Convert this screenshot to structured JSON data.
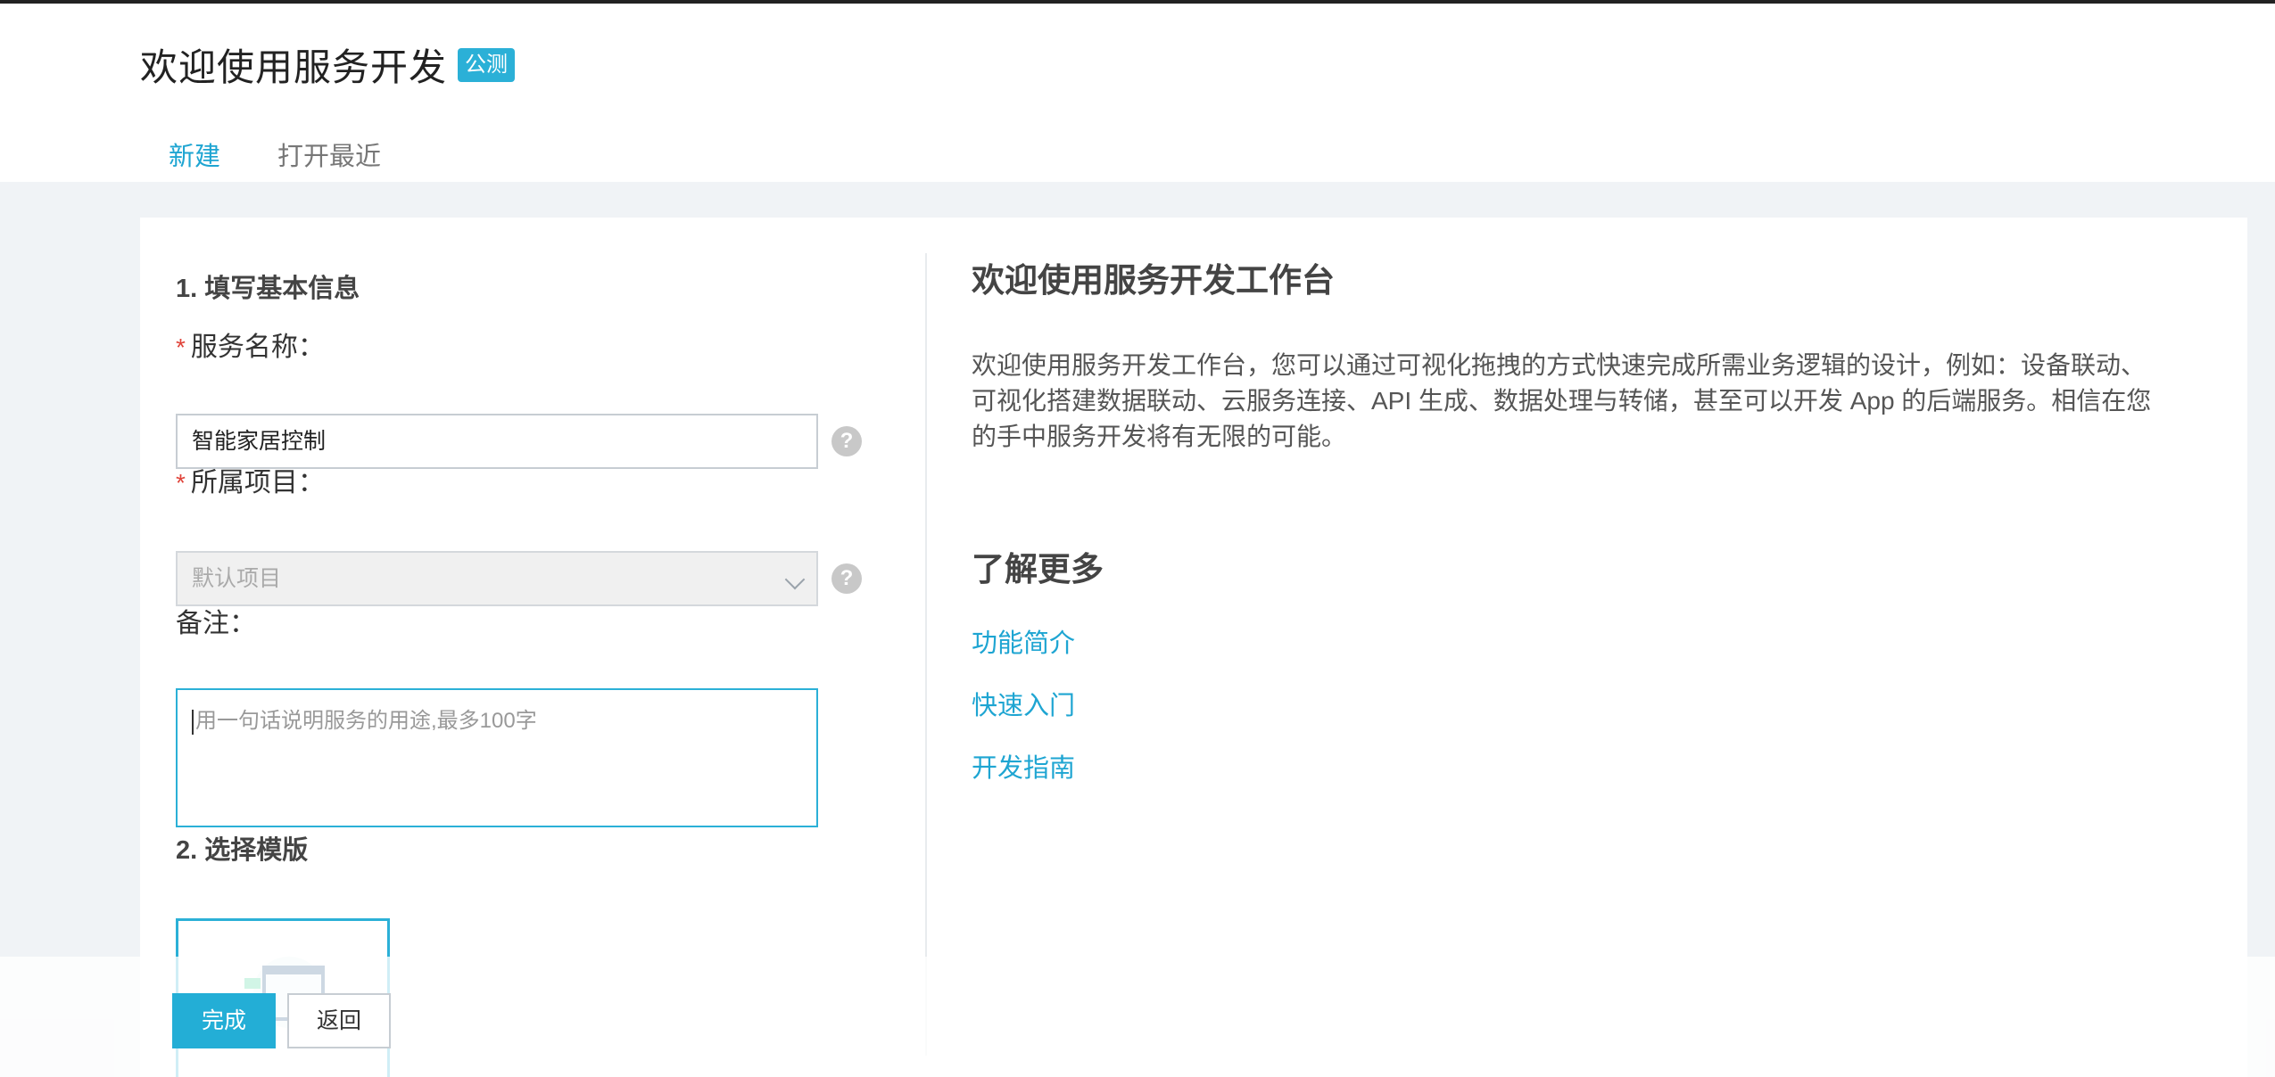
{
  "header": {
    "title": "欢迎使用服务开发",
    "badge": "公测",
    "tabs": [
      {
        "label": "新建",
        "active": true
      },
      {
        "label": "打开最近",
        "active": false
      }
    ]
  },
  "form": {
    "section1_title": "1. 填写基本信息",
    "service_name": {
      "label": "服务名称：",
      "value": "智能家居控制",
      "required": true
    },
    "project": {
      "label": "所属项目：",
      "placeholder": "默认项目",
      "required": true
    },
    "remark": {
      "label": "备注：",
      "placeholder": "用一句话说明服务的用途,最多100字"
    },
    "section2_title": "2. 选择模版"
  },
  "help_icon": "?",
  "info": {
    "title": "欢迎使用服务开发工作台",
    "description": "欢迎使用服务开发工作台，您可以通过可视化拖拽的方式快速完成所需业务逻辑的设计，例如：设备联动、可视化搭建数据联动、云服务连接、API 生成、数据处理与转储，甚至可以开发 App 的后端服务。相信在您的手中服务开发将有无限的可能。",
    "more_title": "了解更多",
    "links": [
      "功能简介",
      "快速入门",
      "开发指南"
    ]
  },
  "footer": {
    "done_label": "完成",
    "back_label": "返回"
  },
  "colors": {
    "accent": "#1ea5d2",
    "required": "#e0443a",
    "page_bg": "#f0f3f6"
  }
}
